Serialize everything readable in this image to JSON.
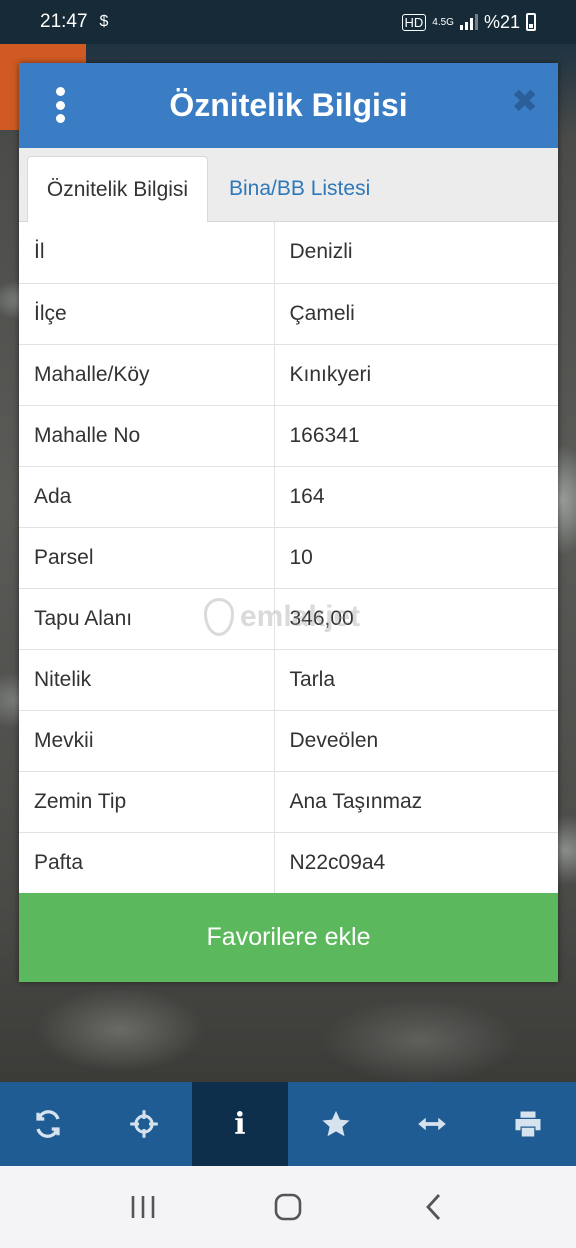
{
  "status_bar": {
    "time": "21:47",
    "currency_icon": "$",
    "network": "4.5G",
    "battery": "%21"
  },
  "dialog": {
    "title": "Öznitelik Bilgisi",
    "close_label": "✖",
    "tabs": [
      {
        "label": "Öznitelik Bilgisi",
        "active": true
      },
      {
        "label": "Bina/BB Listesi",
        "active": false
      }
    ],
    "rows": [
      {
        "key": "İl",
        "value": "Denizli"
      },
      {
        "key": "İlçe",
        "value": "Çameli"
      },
      {
        "key": "Mahalle/Köy",
        "value": "Kınıkyeri"
      },
      {
        "key": "Mahalle No",
        "value": "166341"
      },
      {
        "key": "Ada",
        "value": "164"
      },
      {
        "key": "Parsel",
        "value": "10"
      },
      {
        "key": "Tapu Alanı",
        "value": "346,00"
      },
      {
        "key": "Nitelik",
        "value": "Tarla"
      },
      {
        "key": "Mevkii",
        "value": "Deveölen"
      },
      {
        "key": "Zemin Tip",
        "value": "Ana Taşınmaz"
      },
      {
        "key": "Pafta",
        "value": "N22c09a4"
      }
    ],
    "favorite_button": "Favorilere ekle"
  },
  "watermark": "emlakjet",
  "toolbar": {
    "items": [
      "refresh-icon",
      "crosshair-icon",
      "info-icon",
      "star-icon",
      "measure-icon",
      "print-icon"
    ],
    "active_index": 2,
    "info_glyph": "i"
  },
  "colors": {
    "header": "#3a7dc4",
    "tab_link": "#2f78b8",
    "favorite": "#5cb85c",
    "toolbar": "#1f5c93",
    "toolbar_active": "#0e2f4c"
  }
}
